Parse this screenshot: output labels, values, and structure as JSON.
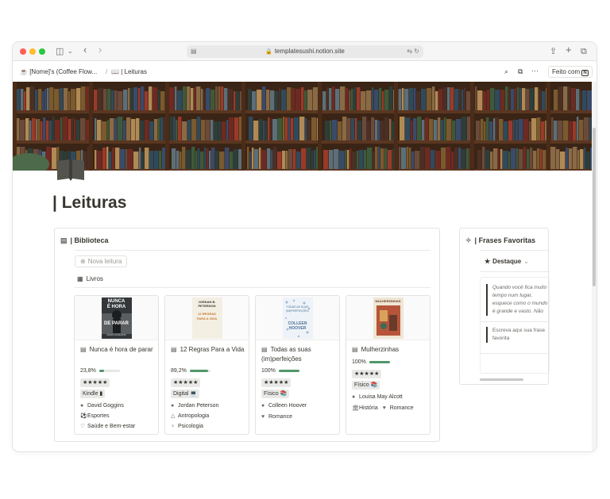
{
  "browser": {
    "url": "templatesushi.notion.site",
    "colors": {
      "close": "#ff5f57",
      "minimize": "#febc2e",
      "zoom": "#28c840"
    }
  },
  "breadcrumb": {
    "workspace": "[Nome]'s (Coffee Flow...",
    "separator": "/",
    "page": "| Leituras"
  },
  "header_actions": {
    "duplicate_label": "Feito com"
  },
  "page": {
    "title": "| Leituras"
  },
  "biblioteca": {
    "title": "| Biblioteca",
    "new_button": "Nova leitura",
    "view_tab": "Livros",
    "cards": [
      {
        "title": "Nunca é hora de parar",
        "cover_text": {
          "top": "NUNCA",
          "middle": "É HORA",
          "bottom": "DE PARAR",
          "author": "DAVID GOGGINS"
        },
        "progress_label": "23,8%",
        "progress": 0.238,
        "rating": "★★★★★",
        "format": "Kindle ▮",
        "author": "David Goggins",
        "genres": [
          "Esportes",
          "Saúde e Bem-estar"
        ]
      },
      {
        "title": "12 Regras Para a Vida",
        "cover_text": {
          "author": "JORDAN B. PETERSON",
          "middle": "12 REGRAS PARA A VIDA"
        },
        "progress_label": "89,2%",
        "progress": 0.892,
        "rating": "★★★★★",
        "format": "Digital 💻",
        "author": "Jordan Peterson",
        "genres": [
          "Antropologia",
          "Psicologia"
        ]
      },
      {
        "title": "Todas as suas (im)perfeições",
        "cover_text": {
          "top": "TODAS AS SUAS (IM)PERFEIÇÕES",
          "author": "COLLEEN HOOVER"
        },
        "progress_label": "100%",
        "progress": 1.0,
        "rating": "★★★★★",
        "format": "Físico 📚",
        "author": "Colleen Hoover",
        "genres": [
          "Romance"
        ]
      },
      {
        "title": "Mulherzinhas",
        "cover_text": {
          "top": "MULHERZINHAS"
        },
        "progress_label": "100%",
        "progress": 1.0,
        "rating": "★★★★★",
        "format": "Físico 📚",
        "author": "Louisa May Alcott",
        "genres": [
          "História",
          "Romance"
        ]
      }
    ]
  },
  "frases": {
    "title": "| Frases Favoritas",
    "filter": "Destaque",
    "quotes": [
      "Quando você fica muito tempo num lugar, esquece como o mundo é grande e vasto. Não tem nada",
      "Escreva aqui sua frase favorita"
    ]
  }
}
